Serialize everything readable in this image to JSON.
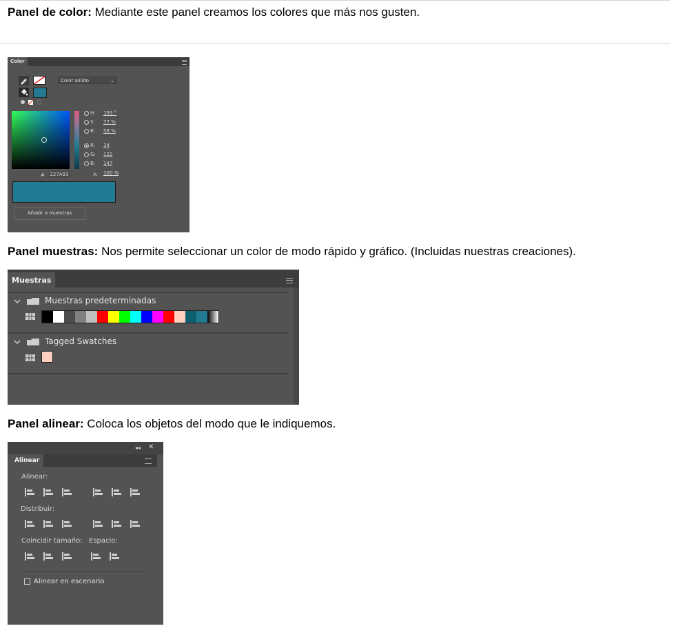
{
  "sections": {
    "color": {
      "bold": "Panel de color:",
      "text": " Mediante este panel creamos los colores que más nos gusten."
    },
    "swatches": {
      "bold": "Panel muestras:",
      "text": " Nos permite seleccionar un color de modo rápido y gráfico. (Incluidas nuestras creaciones)."
    },
    "align": {
      "bold": "Panel alinear:",
      "text": " Coloca los objetos del modo que le indiquemos."
    }
  },
  "color_panel": {
    "tab": "Color",
    "fill_type": "Color sólido",
    "fields": [
      {
        "label": "H:",
        "value": "193",
        "unit": "°",
        "selected": false
      },
      {
        "label": "S:",
        "value": "77",
        "unit": "%",
        "selected": false
      },
      {
        "label": "B:",
        "value": "58",
        "unit": "%",
        "selected": false
      },
      {
        "label": "R:",
        "value": "34",
        "unit": "",
        "selected": true
      },
      {
        "label": "G:",
        "value": "122",
        "unit": "",
        "selected": false
      },
      {
        "label": "B:",
        "value": "147",
        "unit": "",
        "selected": false
      }
    ],
    "hex_label": "#",
    "hex_value": "227A93",
    "alpha_label": "A:",
    "alpha_value": "100",
    "alpha_unit": "%",
    "current_color": "#227A93",
    "add_button": "Añadir a muestras"
  },
  "swatches_panel": {
    "tab": "Muestras",
    "groups": [
      {
        "name": "Muestras predeterminadas",
        "swatches": [
          "#000000",
          "#ffffff",
          "#4d4d4d",
          "#808080",
          "#c0c0c0",
          "#ff0000",
          "#ffff00",
          "#00ff00",
          "#00ffff",
          "#0000ff",
          "#ff00ff",
          "#ff0000",
          "#ffd0c0",
          "#0e6070",
          "#227a93",
          "gradient-black-white"
        ]
      },
      {
        "name": "Tagged Swatches",
        "swatches": [
          "#ffd0c0"
        ]
      }
    ]
  },
  "align_panel": {
    "tab": "Alinear",
    "align_label": "Alinear:",
    "distribute_label": "Distribuir:",
    "match_size_label": "Coincidir tamaño:",
    "space_label": "Espacio:",
    "stage_checkbox": "Alinear en escenario",
    "stage_checked": false
  }
}
